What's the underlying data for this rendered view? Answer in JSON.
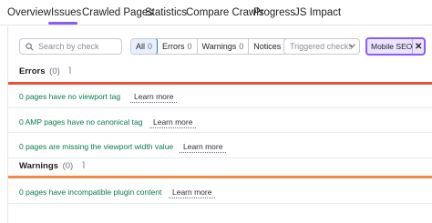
{
  "nav": {
    "tabs": [
      {
        "label": "Overview"
      },
      {
        "label": "Issues"
      },
      {
        "label": "Crawled Pages"
      },
      {
        "label": "Statistics"
      },
      {
        "label": "Compare Crawls"
      },
      {
        "label": "Progress"
      },
      {
        "label": "JS Impact"
      }
    ],
    "active_tab": "Issues",
    "accent_color": "#8b5cf6"
  },
  "toolbar": {
    "search_placeholder": "Search by check",
    "filters": [
      {
        "label": "All",
        "count": "0",
        "active": true
      },
      {
        "label": "Errors",
        "count": "0"
      },
      {
        "label": "Warnings",
        "count": "0"
      },
      {
        "label": "Notices",
        "count": "0"
      }
    ],
    "dropdown_placeholder": "Triggered checks",
    "chip_label": "Mobile SEO",
    "chip_close": "✕"
  },
  "errors": {
    "title": "Errors",
    "count": "(0)",
    "color": "#e5533d",
    "rows": [
      {
        "text": "0 pages have no viewport tag",
        "link": "Learn more"
      },
      {
        "text": "0 AMP pages have no canonical tag",
        "link": "Learn more"
      },
      {
        "text": "0 pages are missing the viewport width value",
        "link": "Learn more"
      }
    ]
  },
  "warnings": {
    "title": "Warnings",
    "count": "(0)",
    "color": "#f08a47",
    "rows": [
      {
        "text": "0 pages have incompatible plugin content",
        "link": "Learn more"
      }
    ]
  }
}
